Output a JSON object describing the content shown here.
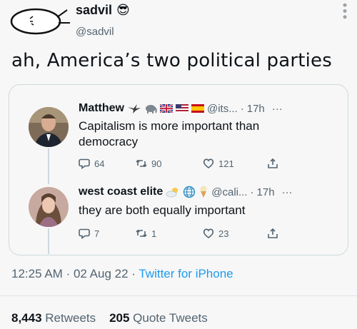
{
  "author": {
    "display_name": "sadvil",
    "name_emoji": "😎",
    "handle": "@sadvil"
  },
  "tweet": {
    "text": "ah, America’s two political parties",
    "time": "12:25 AM",
    "date": "02 Aug 22",
    "source": "Twitter for iPhone",
    "retweets_count": "8,443",
    "retweets_label": "Retweets",
    "quotes_count": "205",
    "quotes_label": "Quote Tweets"
  },
  "quote": {
    "first": {
      "name": "Matthew",
      "handle": "@its...",
      "time": "17h",
      "dots": "···",
      "text": "Capitalism is more important than democracy",
      "replies": "64",
      "retweets": "90",
      "likes": "121"
    },
    "second": {
      "name": "west coast elite",
      "handle": "@cali...",
      "time": "17h",
      "dots": "···",
      "text": "they are both equally important",
      "replies": "7",
      "retweets": "1",
      "likes": "23"
    }
  },
  "icons": [
    "reply-icon",
    "retweet-icon",
    "like-icon",
    "share-icon"
  ]
}
